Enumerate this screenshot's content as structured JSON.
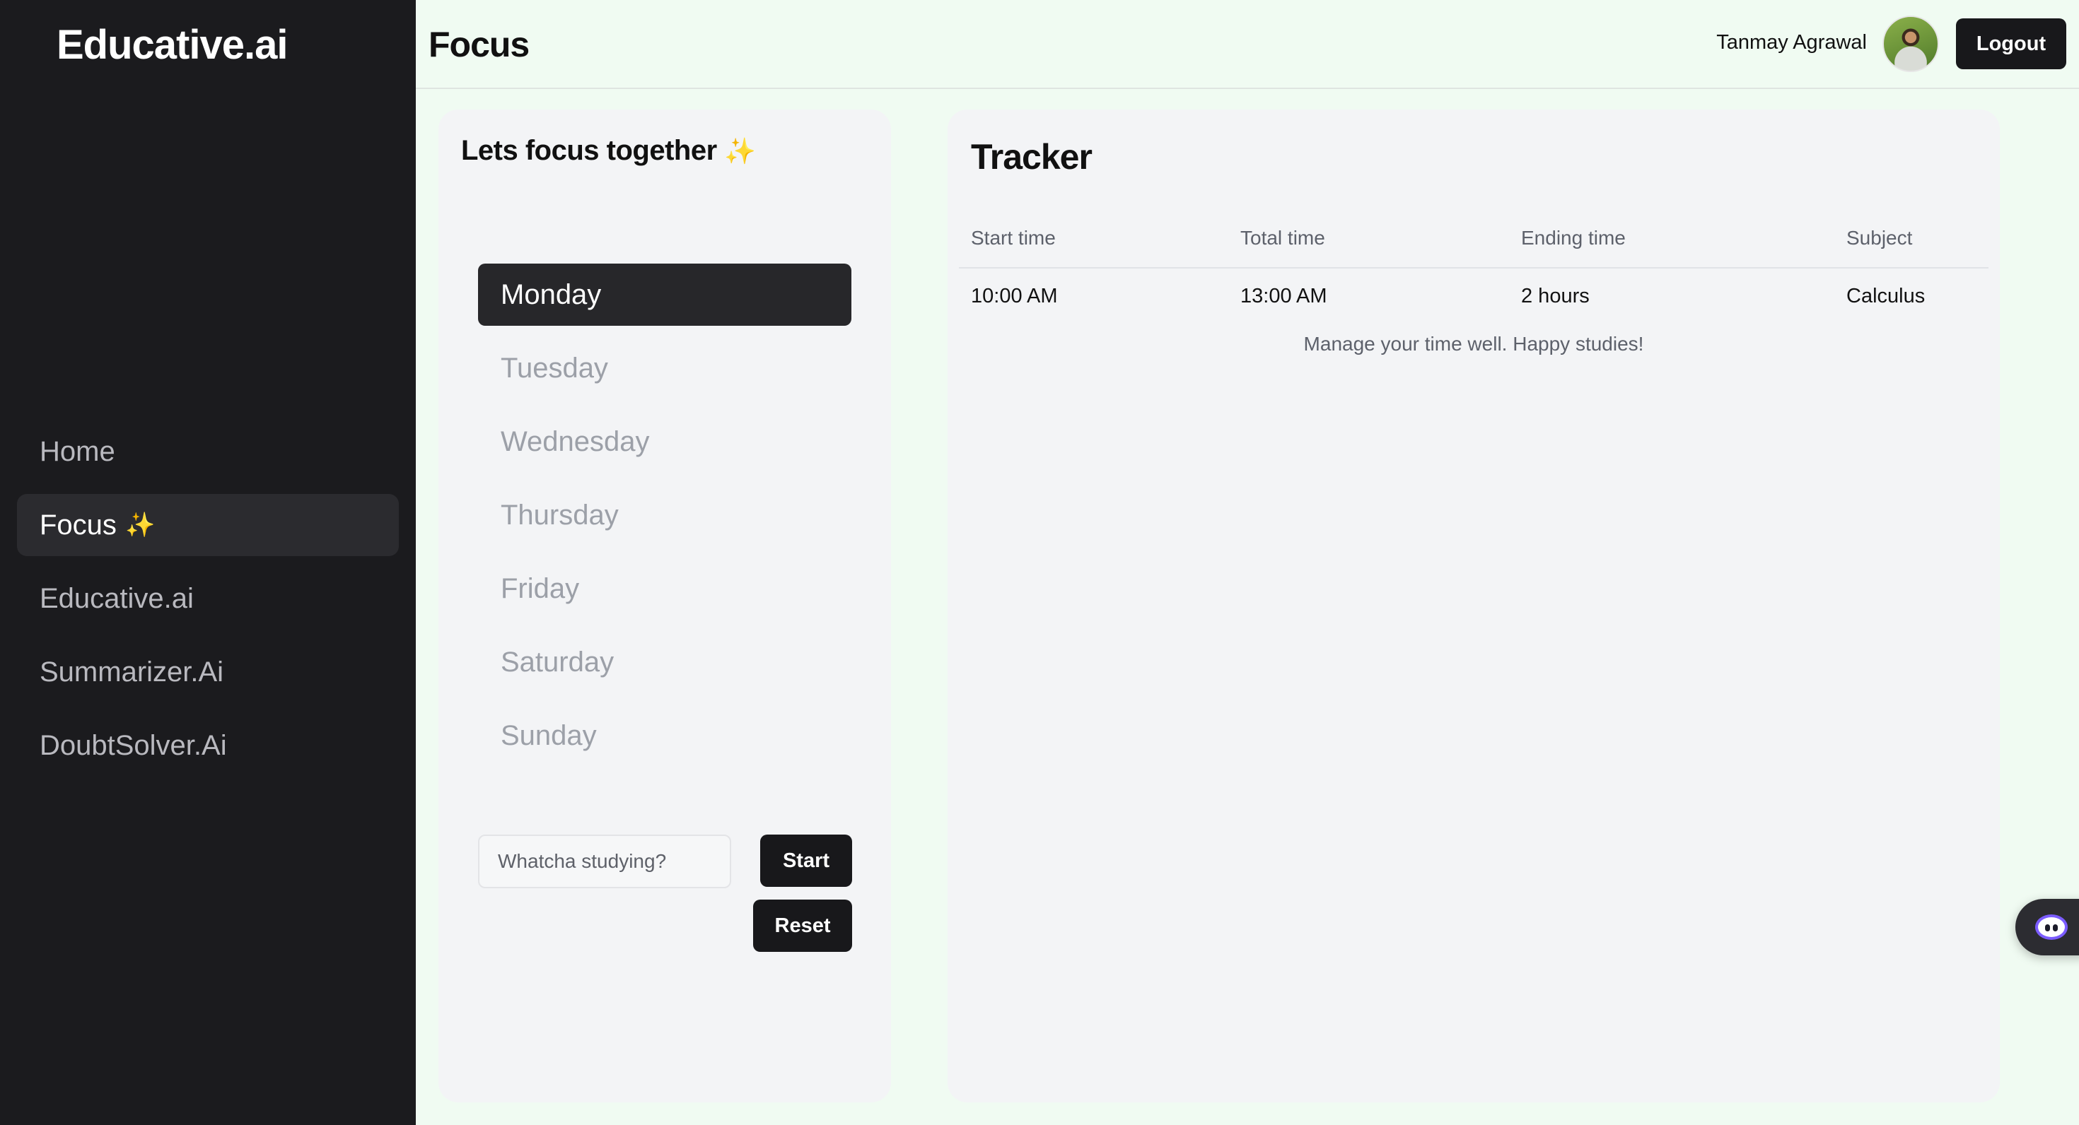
{
  "sidebar": {
    "brand": "Educative.ai",
    "items": [
      {
        "label": "Home",
        "active": false
      },
      {
        "label": "Focus",
        "active": true,
        "icon": "sparkles-icon"
      },
      {
        "label": "Educative.ai",
        "active": false
      },
      {
        "label": "Summarizer.Ai",
        "active": false
      },
      {
        "label": "DoubtSolver.Ai",
        "active": false
      }
    ]
  },
  "header": {
    "title": "Focus",
    "user_name": "Tanmay Agrawal",
    "logout_label": "Logout"
  },
  "focus": {
    "title": "Lets focus together",
    "title_icon": "sparkles-icon",
    "days": [
      "Monday",
      "Tuesday",
      "Wednesday",
      "Thursday",
      "Friday",
      "Saturday",
      "Sunday"
    ],
    "selected_day": "Monday",
    "input_placeholder": "Whatcha studying?",
    "input_value": "",
    "start_label": "Start",
    "reset_label": "Reset"
  },
  "tracker": {
    "title": "Tracker",
    "columns": [
      "Start time",
      "Total time",
      "Ending time",
      "Subject"
    ],
    "rows": [
      [
        "10:00 AM",
        "13:00 AM",
        "2 hours",
        "Calculus"
      ]
    ],
    "caption": "Manage your time well. Happy studies!"
  },
  "colors": {
    "sidebar_bg": "#1b1b1e",
    "page_bg": "#f0fbf2",
    "panel_bg": "#f3f4f6",
    "button_bg": "#18181b",
    "accent_spark": "#f2d15a"
  },
  "chat_widget": {
    "icon": "chatbot-face-icon"
  }
}
